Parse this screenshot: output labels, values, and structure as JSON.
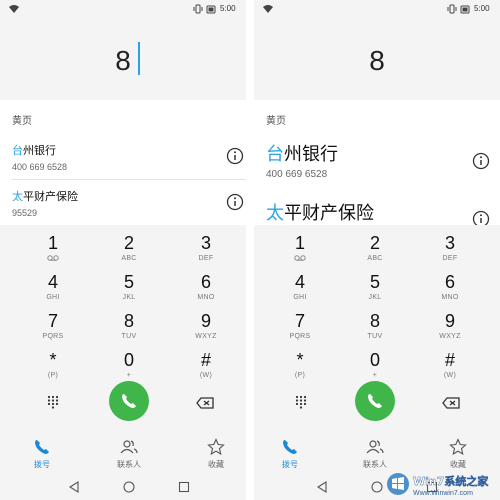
{
  "accent_color": "#29a3e6",
  "call_color": "#3fb54a",
  "status_bar": {
    "time": "5:00",
    "icons": [
      "wifi-icon",
      "vibrate-icon",
      "battery-icon"
    ]
  },
  "screens": [
    {
      "dialed": "8",
      "section": "黄页",
      "contacts": [
        {
          "name_highlight": "台",
          "name_rest": "州银行",
          "number": "400 669 6528"
        },
        {
          "name_highlight": "太",
          "name_rest": "平财产保险",
          "number": "95529"
        }
      ]
    },
    {
      "dialed": "8",
      "section": "黄页",
      "contacts": [
        {
          "name_highlight": "台",
          "name_rest": "州银行",
          "number": "400 669 6528"
        },
        {
          "name_highlight": "太",
          "name_rest": "平财产保险"
        }
      ]
    }
  ],
  "keypad": [
    {
      "digit": "1",
      "letters": ""
    },
    {
      "digit": "2",
      "letters": "ABC"
    },
    {
      "digit": "3",
      "letters": "DEF"
    },
    {
      "digit": "4",
      "letters": "GHI"
    },
    {
      "digit": "5",
      "letters": "JKL"
    },
    {
      "digit": "6",
      "letters": "MNO"
    },
    {
      "digit": "7",
      "letters": "PQRS"
    },
    {
      "digit": "8",
      "letters": "TUV"
    },
    {
      "digit": "9",
      "letters": "WXYZ"
    },
    {
      "digit": "*",
      "letters": "(P)"
    },
    {
      "digit": "0",
      "letters": "+"
    },
    {
      "digit": "#",
      "letters": "(W)"
    }
  ],
  "tabs": [
    {
      "label": "拨号",
      "icon": "phone-icon",
      "active": true
    },
    {
      "label": "联系人",
      "icon": "contacts-icon",
      "active": false
    },
    {
      "label": "收藏",
      "icon": "star-icon",
      "active": false
    }
  ],
  "nav": [
    "back-icon",
    "home-icon",
    "recents-icon"
  ],
  "watermark": {
    "brand": "Win7系统之家",
    "url": "Www.Winwin7.com"
  }
}
